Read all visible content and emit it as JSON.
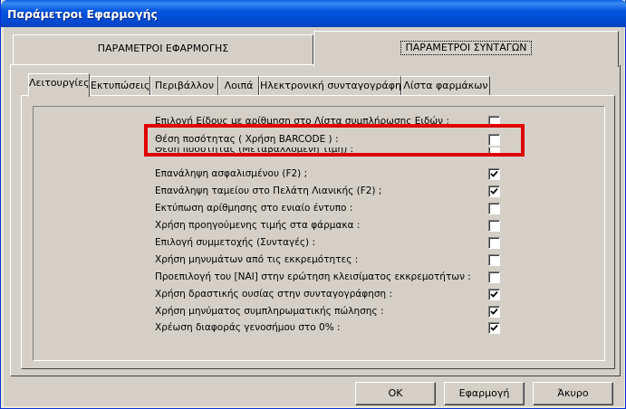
{
  "window": {
    "title": "Παράμετροι Εφαρμογής"
  },
  "outer_tabs": [
    {
      "label": "ΠΑΡΑΜΕΤΡΟΙ ΕΦΑΡΜΟΓΗΣ",
      "active": false
    },
    {
      "label": "ΠΑΡΑΜΕΤΡΟΙ ΣΥΝΤΑΓΩΝ",
      "active": true
    }
  ],
  "inner_tabs": [
    {
      "label": "Λειτουργίες",
      "active": true
    },
    {
      "label": "Εκτυπώσεις",
      "active": false
    },
    {
      "label": "Περιβάλλον",
      "active": false
    },
    {
      "label": "Λοιπά",
      "active": false
    },
    {
      "label": "Ηλεκτρονική συνταγογράφηση",
      "active": false
    },
    {
      "label": "Λίστα φαρμάκων",
      "active": false
    }
  ],
  "options": [
    {
      "label": "Επιλογή Είδους με αρίθμηση στο Λίστα συμπλήρωσης Ειδών :",
      "checked": false
    },
    {
      "label": "Θέση ποσότητας ( Χρήση BARCODE ) :",
      "checked": false
    },
    {
      "label": "Θέση ποσότητας (Μεταβαλλόμενη τιμή) :",
      "checked": false
    },
    {
      "label": "Επανάληψη ασφαλισμένου (F2) ;",
      "checked": true
    },
    {
      "label": "Επανάληψη ταμείου στο Πελάτη Λιανικής (F2) ;",
      "checked": true
    },
    {
      "label": "Εκτύπωση αρίθμησης στο ενιαίο έντυπο :",
      "checked": false
    },
    {
      "label": "Χρήση προηγούμενης τιμής στα φάρμακα :",
      "checked": false
    },
    {
      "label": "Επιλογή συμμετοχής (Συνταγές) :",
      "checked": false
    },
    {
      "label": "Χρήση μηνυμάτων από τις εκκρεμότητες :",
      "checked": false
    },
    {
      "label": "Προεπιλογή του [ΝΑΙ] στην ερώτηση κλεισίματος εκκρεμοτήτων :",
      "checked": false
    },
    {
      "label": "Χρήση δραστικής ουσίας στην συνταγογράφηση :",
      "checked": true
    },
    {
      "label": "Χρήση μηνύματος συμπληρωματικής πώλησης :",
      "checked": true
    },
    {
      "label": "Χρέωση διαφοράς γενοσήμου στο 0% :",
      "checked": true
    }
  ],
  "buttons": {
    "ok": "ΟΚ",
    "apply": "Εφαρμογή",
    "cancel": "Άκυρο"
  },
  "colors": {
    "title_bar": "#0556e0",
    "highlight": "#e00000",
    "dialog": "#d4d0c8"
  }
}
